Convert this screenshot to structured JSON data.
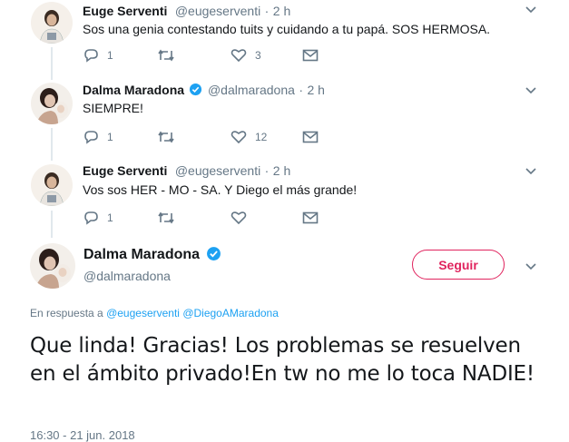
{
  "tweets": [
    {
      "name": "Euge Serventi",
      "handle": "@eugeserventi",
      "sep": "·",
      "time": "2 h",
      "text": "Sos una genia contestando tuits y cuidando a tu papá. SOS HERMOSA.",
      "reply_count": "1",
      "retweet_count": "",
      "like_count": "3"
    },
    {
      "name": "Dalma Maradona",
      "handle": "@dalmaradona",
      "sep": "·",
      "time": "2 h",
      "text": "SIEMPRE!",
      "reply_count": "1",
      "retweet_count": "",
      "like_count": "12"
    },
    {
      "name": "Euge Serventi",
      "handle": "@eugeserventi",
      "sep": "·",
      "time": "2 h",
      "text": "Vos sos HER - MO - SA. Y Diego el más grande!",
      "reply_count": "1",
      "retweet_count": "",
      "like_count": ""
    }
  ],
  "main_tweet": {
    "name": "Dalma Maradona",
    "handle": "@dalmaradona",
    "follow_label": "Seguir",
    "reply_prefix": "En respuesta a",
    "reply_to_1": "@eugeserventi",
    "reply_to_2": "@DiegoAMaradona",
    "text": "Que linda! Gracias! Los problemas se resuelven en el ámbito privado!En tw no me lo toca NADIE!",
    "timestamp": "16:30 - 21 jun. 2018"
  },
  "icons": {
    "reply": "reply-icon",
    "retweet": "retweet-icon",
    "like": "heart-icon",
    "dm": "envelope-icon",
    "more": "chevron-down-icon",
    "verified": "verified-badge-icon"
  },
  "colors": {
    "accent": "#1da1f2",
    "follow": "#e0245e",
    "muted": "#657786",
    "thread": "#e1e8ed"
  }
}
